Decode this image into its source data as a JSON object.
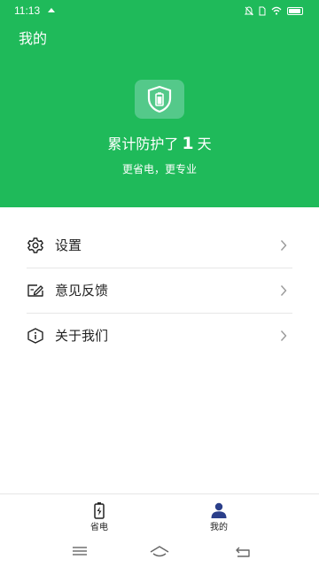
{
  "status_bar": {
    "time": "11:13"
  },
  "header": {
    "title": "我的",
    "days_prefix": "累计防护了",
    "days_count": "1",
    "days_suffix": "天",
    "subtitle": "更省电，更专业"
  },
  "menu": {
    "items": [
      {
        "label": "设置",
        "icon": "gear-icon"
      },
      {
        "label": "意见反馈",
        "icon": "feedback-icon"
      },
      {
        "label": "关于我们",
        "icon": "info-icon"
      }
    ]
  },
  "tabbar": {
    "tabs": [
      {
        "label": "省电",
        "icon": "battery-icon"
      },
      {
        "label": "我的",
        "icon": "person-icon",
        "active": true
      }
    ]
  },
  "colors": {
    "brand": "#1fba5a",
    "active_tab": "#2b3f8a"
  }
}
